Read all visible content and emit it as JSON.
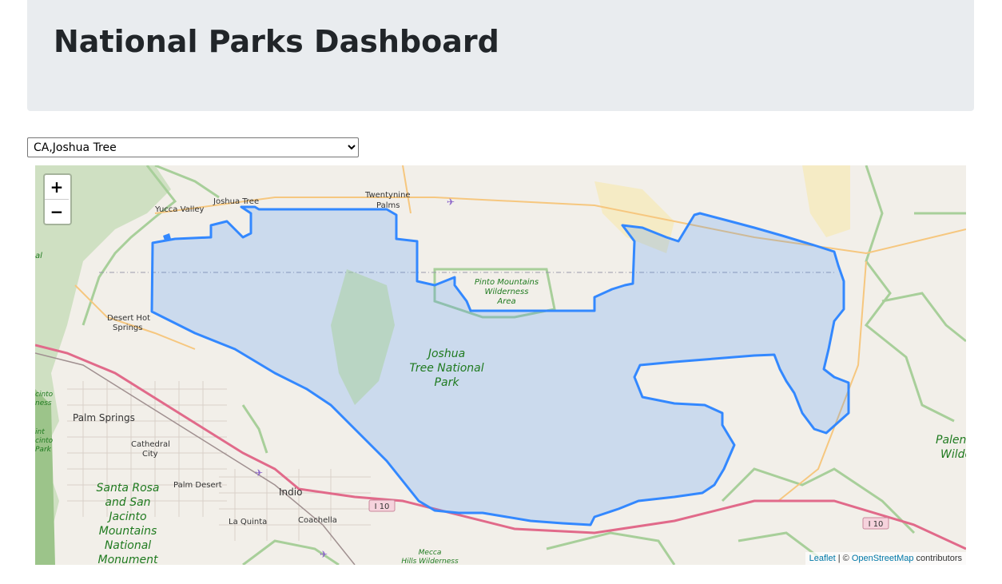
{
  "header": {
    "title": "National Parks Dashboard"
  },
  "park_select": {
    "selected": "CA,Joshua Tree"
  },
  "map": {
    "zoom_in": "+",
    "zoom_out": "−",
    "attribution": {
      "leaflet": "Leaflet",
      "sep": " | © ",
      "osm": "OpenStreetMap",
      "suffix": " contributors"
    },
    "park_label": [
      "Joshua",
      "Tree National",
      "Park"
    ],
    "places": {
      "yucca_valley": "Yucca Valley",
      "joshua_tree": "Joshua Tree",
      "twentynine": "Twentynine",
      "palms": "Palms",
      "desert_hot": "Desert Hot",
      "springs": "Springs",
      "palm_springs": "Palm Springs",
      "cathedral": "Cathedral",
      "city": "City",
      "palm_desert": "Palm Desert",
      "indio": "Indio",
      "la_quinta": "La Quinta",
      "coachella": "Coachella"
    },
    "areas": {
      "pinto": [
        "Pinto Mountains",
        "Wilderness",
        "Area"
      ],
      "santa_rosa": [
        "Santa Rosa",
        "and San",
        "Jacinto",
        "Mountains",
        "National",
        "Monument"
      ],
      "mecca": [
        "Mecca",
        "Hills Wilderness"
      ],
      "palen": [
        "Palen",
        "Wilde"
      ],
      "left_edge": [
        "al",
        "cinto",
        "ness",
        "int",
        "cinto",
        "Park"
      ]
    },
    "highway": "I 10",
    "colors": {
      "boundary": "#3388ff",
      "fill": "#3388ff",
      "highway": "#e16a8a",
      "green": "#a8cf9a"
    }
  }
}
